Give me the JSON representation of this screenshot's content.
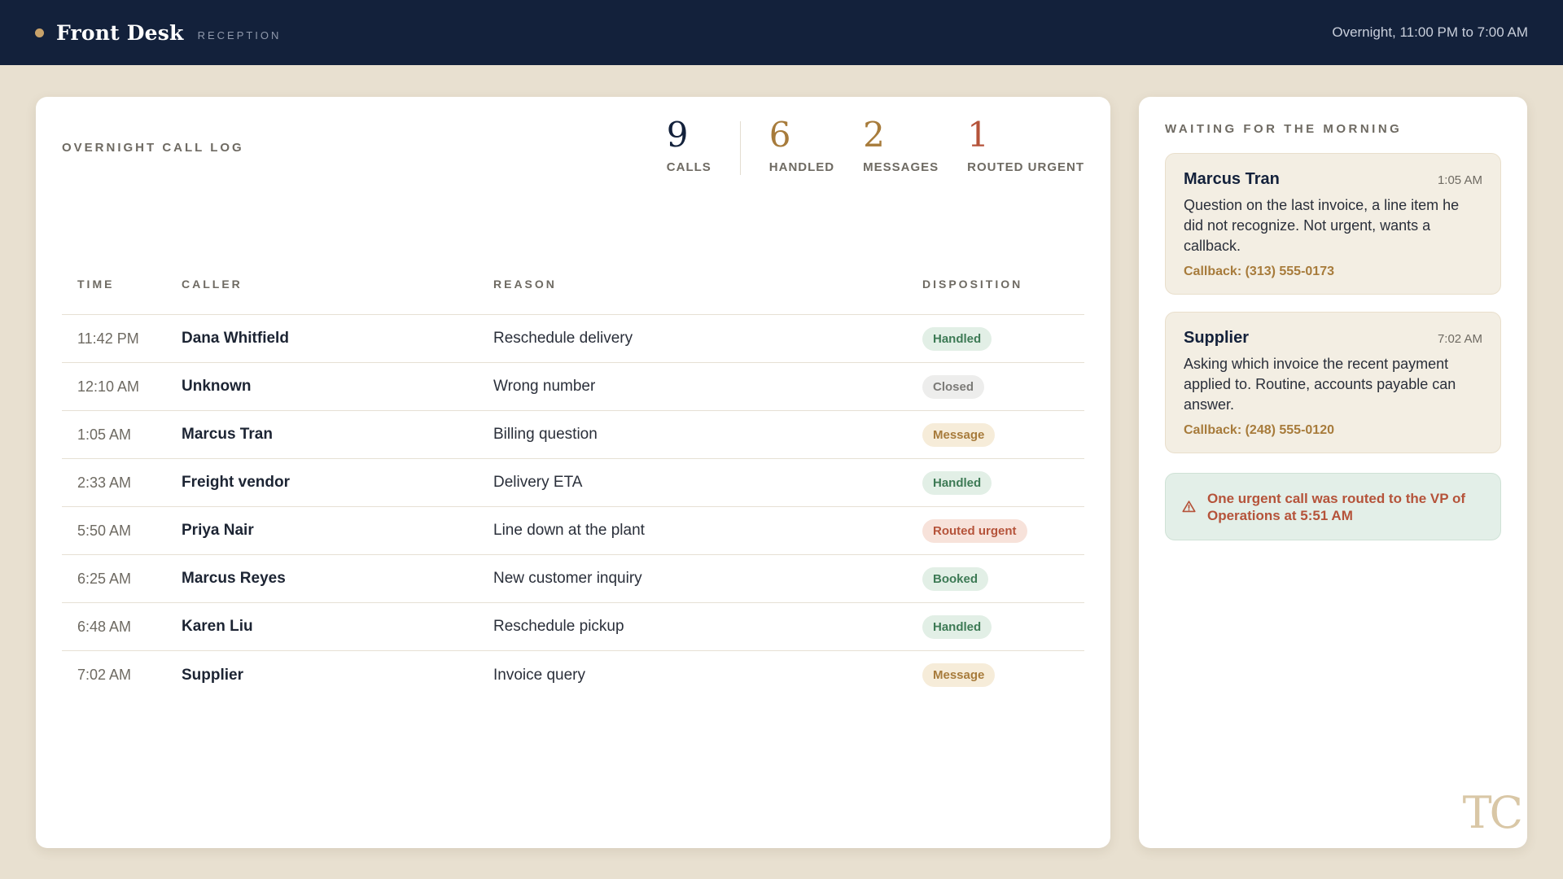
{
  "header": {
    "title": "Front Desk",
    "subtitle": "RECEPTION",
    "shift": "Overnight, 11:00 PM to 7:00 AM"
  },
  "log": {
    "title": "OVERNIGHT CALL LOG",
    "stats": {
      "calls": {
        "value": "9",
        "label": "CALLS"
      },
      "handled": {
        "value": "6",
        "label": "HANDLED"
      },
      "messages": {
        "value": "2",
        "label": "MESSAGES"
      },
      "urgent": {
        "value": "1",
        "label": "ROUTED URGENT"
      }
    },
    "columns": {
      "time": "TIME",
      "caller": "CALLER",
      "reason": "REASON",
      "disposition": "DISPOSITION"
    },
    "rows": [
      {
        "time": "11:42 PM",
        "caller": "Dana Whitfield",
        "reason": "Reschedule delivery",
        "disposition": "Handled",
        "type": "handled"
      },
      {
        "time": "12:10 AM",
        "caller": "Unknown",
        "reason": "Wrong number",
        "disposition": "Closed",
        "type": "closed"
      },
      {
        "time": "1:05 AM",
        "caller": "Marcus Tran",
        "reason": "Billing question",
        "disposition": "Message",
        "type": "message"
      },
      {
        "time": "2:33 AM",
        "caller": "Freight vendor",
        "reason": "Delivery ETA",
        "disposition": "Handled",
        "type": "handled"
      },
      {
        "time": "5:50 AM",
        "caller": "Priya Nair",
        "reason": "Line down at the plant",
        "disposition": "Routed urgent",
        "type": "urgent"
      },
      {
        "time": "6:25 AM",
        "caller": "Marcus Reyes",
        "reason": "New customer inquiry",
        "disposition": "Booked",
        "type": "booked"
      },
      {
        "time": "6:48 AM",
        "caller": "Karen Liu",
        "reason": "Reschedule pickup",
        "disposition": "Handled",
        "type": "handled"
      },
      {
        "time": "7:02 AM",
        "caller": "Supplier",
        "reason": "Invoice query",
        "disposition": "Message",
        "type": "message"
      }
    ]
  },
  "side": {
    "title": "WAITING FOR THE MORNING",
    "messages": [
      {
        "name": "Marcus Tran",
        "time": "1:05 AM",
        "body": "Question on the last invoice, a line item he did not recognize. Not urgent, wants a callback.",
        "callback": "Callback: (313) 555-0173"
      },
      {
        "name": "Supplier",
        "time": "7:02 AM",
        "body": "Asking which invoice the recent payment applied to. Routine, accounts payable can answer.",
        "callback": "Callback: (248) 555-0120"
      }
    ],
    "alert": {
      "icon": "warning-triangle-icon",
      "text": "One urgent call was routed to the VP of Operations at 5:51 AM"
    },
    "monogram": "TC"
  },
  "colors": {
    "navy": "#13213b",
    "gold": "#a77b3b",
    "urgent": "#b5533a",
    "green": "#3d7a55",
    "background": "#e8e0d0"
  }
}
